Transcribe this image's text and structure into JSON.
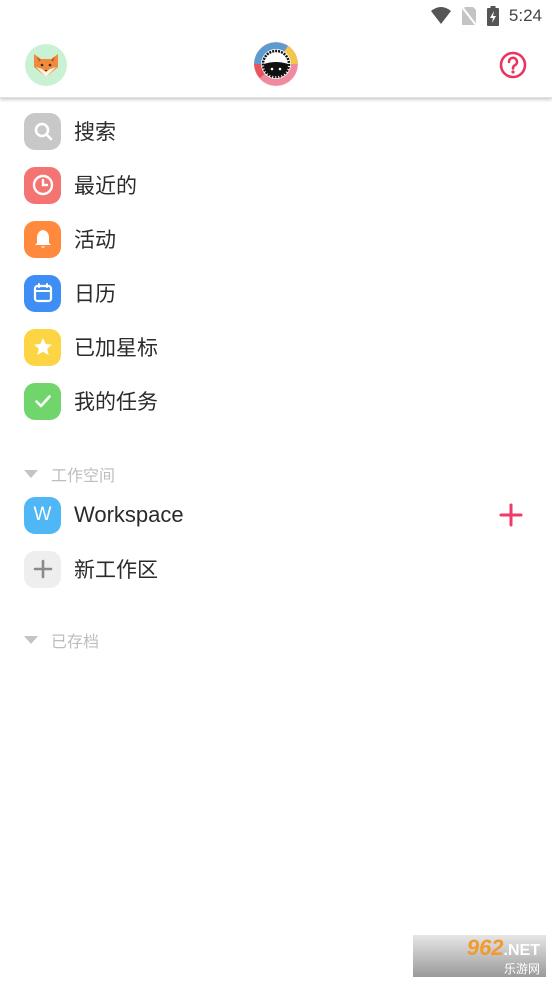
{
  "status_bar": {
    "time": "5:24",
    "icons": [
      "wifi-icon",
      "no-sim-icon",
      "battery-charging-icon"
    ]
  },
  "top_bar": {
    "user_avatar": "fox-avatar",
    "logo": "taskade-logo",
    "help_icon": "help-circle-icon"
  },
  "menu": {
    "items": [
      {
        "label": "搜索",
        "icon": "search-icon",
        "color": "#c8c8c8"
      },
      {
        "label": "最近的",
        "icon": "clock-icon",
        "color": "#f47373"
      },
      {
        "label": "活动",
        "icon": "bell-icon",
        "color": "#ff8a3d"
      },
      {
        "label": "日历",
        "icon": "calendar-icon",
        "color": "#3f8ef5"
      },
      {
        "label": "已加星标",
        "icon": "star-icon",
        "color": "#fdd443"
      },
      {
        "label": "我的任务",
        "icon": "check-icon",
        "color": "#70d66b"
      }
    ]
  },
  "workspaces": {
    "section_label": "工作空间",
    "items": [
      {
        "initial": "W",
        "label": "Workspace",
        "color": "#4fb7f5"
      }
    ],
    "new_label": "新工作区",
    "add_color": "#f03a6a"
  },
  "archived": {
    "section_label": "已存档"
  },
  "watermark": {
    "number": "962",
    "domain": ".NET",
    "site_name": "乐游网"
  },
  "colors": {
    "accent": "#e8345f"
  }
}
